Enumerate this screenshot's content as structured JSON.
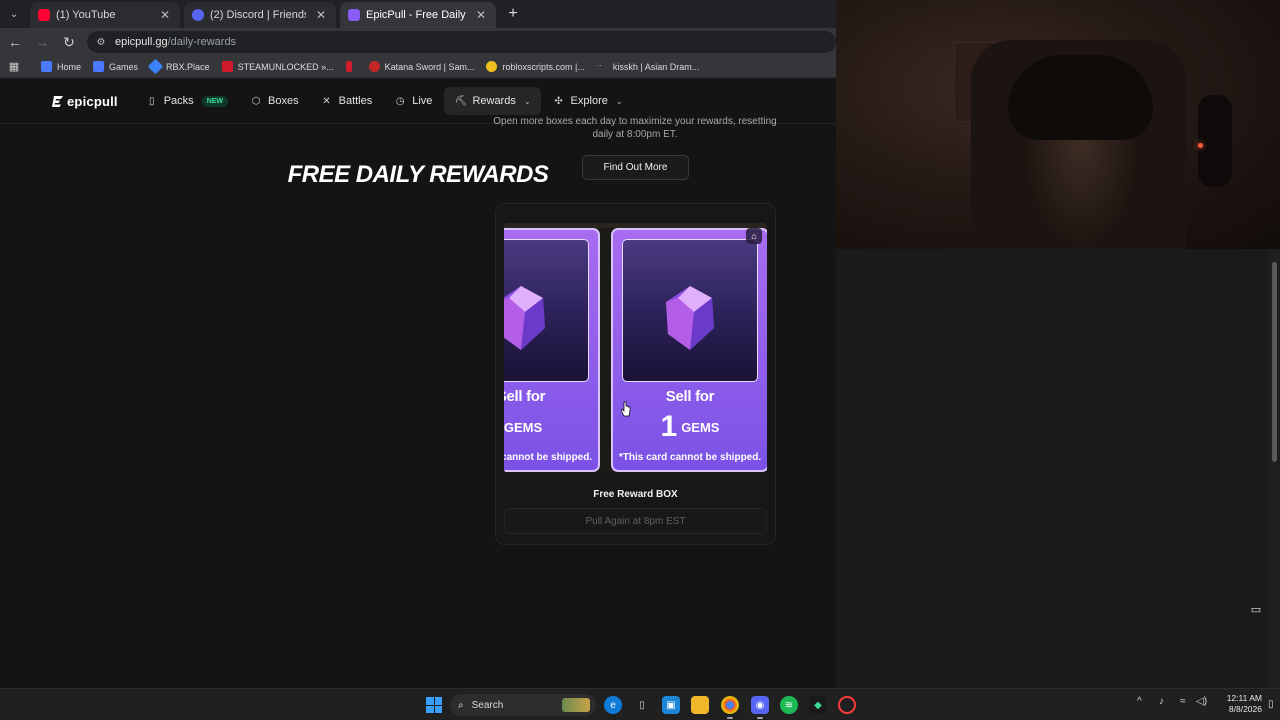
{
  "browser": {
    "tabs": [
      {
        "title": "(1) YouTube",
        "favicon_color": "#ff0033",
        "active": false
      },
      {
        "title": "(2) Discord | Friends",
        "favicon_color": "#5865f2",
        "active": false
      },
      {
        "title": "EpicPull - Free Daily Rewards",
        "favicon_color": "#8a5cf6",
        "active": true
      }
    ],
    "close_glyph": "✕",
    "new_tab_glyph": "+",
    "url_host": "epicpull.gg",
    "url_path": "/daily-rewards",
    "bookmarks": [
      {
        "label": "Home",
        "icon_color": "#4a78ff"
      },
      {
        "label": "Games",
        "icon_color": "#4a78ff"
      },
      {
        "label": "RBX.Place",
        "icon_color": "#3b82f6"
      },
      {
        "label": "STEAMUNLOCKED »...",
        "icon_color": "#d11a2a"
      },
      {
        "label": "",
        "icon_color": "#d11a2a"
      },
      {
        "label": "Katana Sword | Sam...",
        "icon_color": "#c62828"
      },
      {
        "label": "robloxscripts.com |...",
        "icon_color": "#f0c020"
      },
      {
        "label": "kisskh | Asian Dram...",
        "icon_color": "#888888"
      }
    ]
  },
  "site": {
    "logo": "epicpull",
    "nav": [
      {
        "label": "Packs",
        "icon": "packs-icon",
        "glyph": "▯",
        "badge": "NEW"
      },
      {
        "label": "Boxes",
        "icon": "box-icon",
        "glyph": "⬡"
      },
      {
        "label": "Battles",
        "icon": "swords-icon",
        "glyph": "✕"
      },
      {
        "label": "Live",
        "icon": "clock-icon",
        "glyph": "◷"
      },
      {
        "label": "Rewards",
        "icon": "rewards-icon",
        "glyph": "⛏",
        "chevron": "⌄",
        "active": true
      },
      {
        "label": "Explore",
        "icon": "explore-icon",
        "glyph": "✣",
        "chevron": "⌄"
      }
    ],
    "hero_title": "FREE DAILY REWARDS",
    "hero_subtitle": "Open more boxes each day to maximize your rewards, resetting daily at 8:00pm ET.",
    "find_out_more": "Find Out More",
    "reward": {
      "box_name": "Free Reward BOX",
      "pull_again": "Pull Again at 8pm EST",
      "card_left": {
        "sell": "Sell for",
        "amount": "",
        "gems": "GEMS",
        "note": "*This card cannot be shipped."
      },
      "card_right": {
        "sell": "Sell for",
        "amount": "1",
        "gems": "GEMS",
        "note": "*This card cannot be shipped."
      }
    }
  },
  "taskbar": {
    "search": "Search",
    "time": "12:11 AM",
    "date": "8/8/2026",
    "apps": [
      "file-explorer-icon",
      "edge-icon",
      "mouse-app-icon",
      "photos-icon",
      "folder-icon",
      "chrome-icon",
      "discord-icon",
      "spotify-icon",
      "game-app-icon",
      "opera-gx-icon"
    ]
  },
  "colors": {
    "accent": "#8a5cf6",
    "card_top": "#a86cf0",
    "card_bottom": "#7b52e6",
    "new_badge": "#3ddc97"
  }
}
